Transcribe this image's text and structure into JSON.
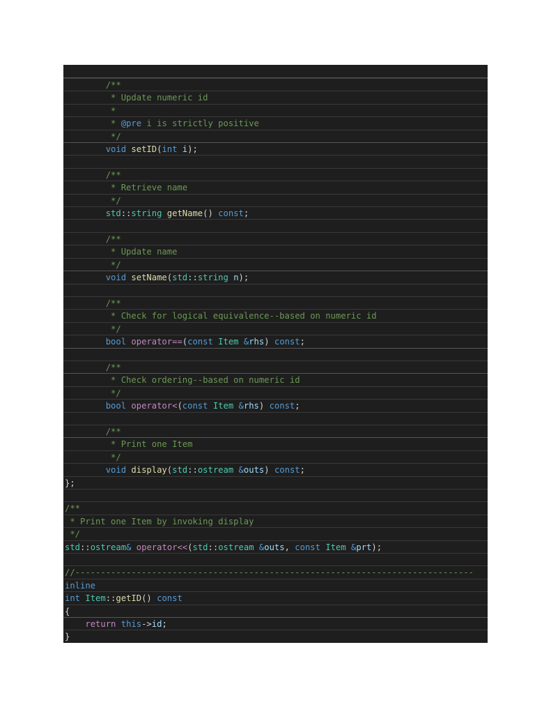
{
  "editor": {
    "language": "C++",
    "lines": [
      [
        {
          "t": "        "
        },
        {
          "c": "cm",
          "t": "/**"
        }
      ],
      [
        {
          "t": "         "
        },
        {
          "c": "cm",
          "t": "* Update numeric id"
        }
      ],
      [
        {
          "t": "         "
        },
        {
          "c": "cm",
          "t": "*"
        }
      ],
      [
        {
          "t": "         "
        },
        {
          "c": "cm",
          "t": "* "
        },
        {
          "c": "tag",
          "t": "@pre"
        },
        {
          "c": "cm",
          "t": " i is strictly positive"
        }
      ],
      [
        {
          "t": "         "
        },
        {
          "c": "cm",
          "t": "*/"
        }
      ],
      [
        {
          "t": "        "
        },
        {
          "c": "kw",
          "t": "void"
        },
        {
          "t": " "
        },
        {
          "c": "fn",
          "t": "setID"
        },
        {
          "t": "("
        },
        {
          "c": "kw",
          "t": "int"
        },
        {
          "t": " "
        },
        {
          "c": "var",
          "t": "i"
        },
        {
          "t": ");"
        }
      ],
      [
        {
          "t": ""
        }
      ],
      [
        {
          "t": "        "
        },
        {
          "c": "cm",
          "t": "/**"
        }
      ],
      [
        {
          "t": "         "
        },
        {
          "c": "cm",
          "t": "* Retrieve name"
        }
      ],
      [
        {
          "t": "         "
        },
        {
          "c": "cm",
          "t": "*/"
        }
      ],
      [
        {
          "t": "        "
        },
        {
          "c": "ty",
          "t": "std"
        },
        {
          "t": "::"
        },
        {
          "c": "ty",
          "t": "string"
        },
        {
          "t": " "
        },
        {
          "c": "fn",
          "t": "getName"
        },
        {
          "t": "() "
        },
        {
          "c": "kw",
          "t": "const"
        },
        {
          "t": ";"
        }
      ],
      [
        {
          "t": ""
        }
      ],
      [
        {
          "t": "        "
        },
        {
          "c": "cm",
          "t": "/**"
        }
      ],
      [
        {
          "t": "         "
        },
        {
          "c": "cm",
          "t": "* Update name"
        }
      ],
      [
        {
          "t": "         "
        },
        {
          "c": "cm",
          "t": "*/"
        }
      ],
      [
        {
          "t": "        "
        },
        {
          "c": "kw",
          "t": "void"
        },
        {
          "t": " "
        },
        {
          "c": "fn",
          "t": "setName"
        },
        {
          "t": "("
        },
        {
          "c": "ty",
          "t": "std"
        },
        {
          "t": "::"
        },
        {
          "c": "ty",
          "t": "string"
        },
        {
          "t": " "
        },
        {
          "c": "var",
          "t": "n"
        },
        {
          "t": ");"
        }
      ],
      [
        {
          "t": ""
        }
      ],
      [
        {
          "t": "        "
        },
        {
          "c": "cm",
          "t": "/**"
        }
      ],
      [
        {
          "t": "         "
        },
        {
          "c": "cm",
          "t": "* Check for logical equivalence--based on numeric id"
        }
      ],
      [
        {
          "t": "         "
        },
        {
          "c": "cm",
          "t": "*/"
        }
      ],
      [
        {
          "t": "        "
        },
        {
          "c": "kw",
          "t": "bool"
        },
        {
          "t": " "
        },
        {
          "c": "op",
          "t": "operator=="
        },
        {
          "t": "("
        },
        {
          "c": "kw",
          "t": "const"
        },
        {
          "t": " "
        },
        {
          "c": "ty",
          "t": "Item"
        },
        {
          "t": " "
        },
        {
          "c": "kw",
          "t": "&"
        },
        {
          "c": "var",
          "t": "rhs"
        },
        {
          "t": ") "
        },
        {
          "c": "kw",
          "t": "const"
        },
        {
          "t": ";"
        }
      ],
      [
        {
          "t": ""
        }
      ],
      [
        {
          "t": "        "
        },
        {
          "c": "cm",
          "t": "/**"
        }
      ],
      [
        {
          "t": "         "
        },
        {
          "c": "cm",
          "t": "* Check ordering--based on numeric id"
        }
      ],
      [
        {
          "t": "         "
        },
        {
          "c": "cm",
          "t": "*/"
        }
      ],
      [
        {
          "t": "        "
        },
        {
          "c": "kw",
          "t": "bool"
        },
        {
          "t": " "
        },
        {
          "c": "op",
          "t": "operator<"
        },
        {
          "t": "("
        },
        {
          "c": "kw",
          "t": "const"
        },
        {
          "t": " "
        },
        {
          "c": "ty",
          "t": "Item"
        },
        {
          "t": " "
        },
        {
          "c": "kw",
          "t": "&"
        },
        {
          "c": "var",
          "t": "rhs"
        },
        {
          "t": ") "
        },
        {
          "c": "kw",
          "t": "const"
        },
        {
          "t": ";"
        }
      ],
      [
        {
          "t": ""
        }
      ],
      [
        {
          "t": "        "
        },
        {
          "c": "cm",
          "t": "/**"
        }
      ],
      [
        {
          "t": "         "
        },
        {
          "c": "cm",
          "t": "* Print one Item"
        }
      ],
      [
        {
          "t": "         "
        },
        {
          "c": "cm",
          "t": "*/"
        }
      ],
      [
        {
          "t": "        "
        },
        {
          "c": "kw",
          "t": "void"
        },
        {
          "t": " "
        },
        {
          "c": "fn",
          "t": "display"
        },
        {
          "t": "("
        },
        {
          "c": "ty",
          "t": "std"
        },
        {
          "t": "::"
        },
        {
          "c": "ty",
          "t": "ostream"
        },
        {
          "t": " "
        },
        {
          "c": "kw",
          "t": "&"
        },
        {
          "c": "var",
          "t": "outs"
        },
        {
          "t": ") "
        },
        {
          "c": "kw",
          "t": "const"
        },
        {
          "t": ";"
        }
      ],
      [
        {
          "t": "};"
        }
      ],
      [
        {
          "t": ""
        }
      ],
      [
        {
          "c": "cm",
          "t": "/**"
        }
      ],
      [
        {
          "c": "cm",
          "t": " * Print one Item by invoking display"
        }
      ],
      [
        {
          "c": "cm",
          "t": " */"
        }
      ],
      [
        {
          "c": "ty",
          "t": "std"
        },
        {
          "t": "::"
        },
        {
          "c": "ty",
          "t": "ostream"
        },
        {
          "c": "kw",
          "t": "&"
        },
        {
          "t": " "
        },
        {
          "c": "op",
          "t": "operator<<"
        },
        {
          "t": "("
        },
        {
          "c": "ty",
          "t": "std"
        },
        {
          "t": "::"
        },
        {
          "c": "ty",
          "t": "ostream"
        },
        {
          "t": " "
        },
        {
          "c": "kw",
          "t": "&"
        },
        {
          "c": "var",
          "t": "outs"
        },
        {
          "t": ", "
        },
        {
          "c": "kw",
          "t": "const"
        },
        {
          "t": " "
        },
        {
          "c": "ty",
          "t": "Item"
        },
        {
          "t": " "
        },
        {
          "c": "kw",
          "t": "&"
        },
        {
          "c": "var",
          "t": "prt"
        },
        {
          "t": ");"
        }
      ],
      [
        {
          "t": ""
        }
      ],
      [
        {
          "c": "cm",
          "t": "//------------------------------------------------------------------------------"
        }
      ],
      [
        {
          "c": "kw",
          "t": "inline"
        }
      ],
      [
        {
          "c": "kw",
          "t": "int"
        },
        {
          "t": " "
        },
        {
          "c": "ty",
          "t": "Item"
        },
        {
          "t": "::"
        },
        {
          "c": "fn",
          "t": "getID"
        },
        {
          "t": "() "
        },
        {
          "c": "kw",
          "t": "const"
        }
      ],
      [
        {
          "t": "{"
        }
      ],
      [
        {
          "t": "    "
        },
        {
          "c": "ctl",
          "t": "return"
        },
        {
          "t": " "
        },
        {
          "c": "kw",
          "t": "this"
        },
        {
          "t": "->"
        },
        {
          "c": "var",
          "t": "id"
        },
        {
          "t": ";"
        }
      ],
      [
        {
          "t": "}"
        }
      ]
    ],
    "separators_after": [
      4,
      14,
      20,
      22,
      27,
      41
    ]
  }
}
